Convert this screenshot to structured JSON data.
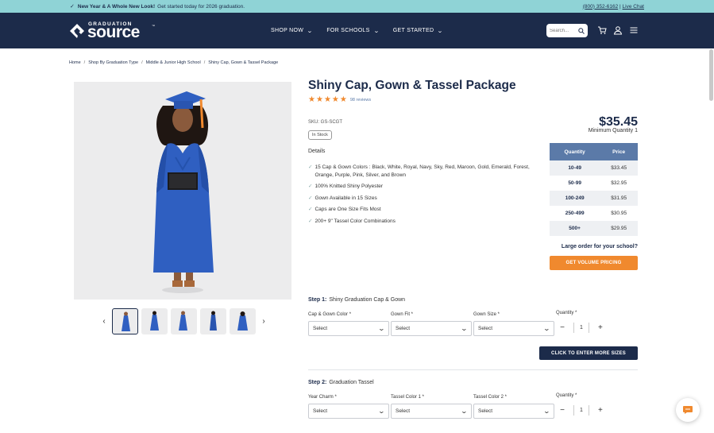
{
  "announcement": {
    "headline": "New Year & A Whole New Look!",
    "text": "Get started today for 2026 graduation.",
    "phone": "(800) 352-6162",
    "separator": "|",
    "live_chat": "Live Chat"
  },
  "header": {
    "logo_small": "GRADUATION",
    "logo_big": "source",
    "logo_tm": "™",
    "menu": [
      {
        "label": "SHOP NOW"
      },
      {
        "label": "FOR SCHOOLS"
      },
      {
        "label": "GET STARTED"
      }
    ],
    "search_placeholder": "Search...",
    "icons": [
      "search-icon",
      "cart-icon",
      "account-icon",
      "menu-icon"
    ]
  },
  "breadcrumb": [
    "Home",
    "Shop By Graduation Type",
    "Middle & Junior High School",
    "Shiny Cap, Gown & Tassel Package"
  ],
  "breadcrumb_separator": "/",
  "product": {
    "title": "Shiny Cap, Gown & Tassel Package",
    "reviews": "98 reviews",
    "stars": 5,
    "sku": "SKU: GS-SCGT",
    "stock": "In Stock",
    "details_label": "Details",
    "details": [
      "15 Cap & Gown Colors : Black, White, Royal, Navy, Sky, Red, Maroon, Gold, Emerald, Forest, Orange, Purple, Pink, Silver, and Brown",
      "100% Knitted Shiny Polyester",
      "Gown Available in 15 Sizes",
      "Caps are One Size Fits Most",
      "200+ 9\" Tassel Color Combinations"
    ],
    "price": "$35.45",
    "min_quantity": "Minimum Quantity 1",
    "image_colors": {
      "gown": "#2f5fc1",
      "tassel": "#f0892e",
      "background": "#ececed"
    }
  },
  "pricing_table": {
    "headers": [
      "Quantity",
      "Price"
    ],
    "rows": [
      {
        "qty": "10-49",
        "price": "$33.45"
      },
      {
        "qty": "50-99",
        "price": "$32.95"
      },
      {
        "qty": "100-249",
        "price": "$31.95"
      },
      {
        "qty": "250-499",
        "price": "$30.95"
      },
      {
        "qty": "500+",
        "price": "$29.95"
      }
    ]
  },
  "volume": {
    "prompt": "Large order for your school?",
    "button": "GET VOLUME PRICING"
  },
  "step1": {
    "label": "Step 1:",
    "name": "Shiny Graduation Cap & Gown",
    "fields": [
      {
        "label": "Cap & Gown Color *",
        "value": "Select"
      },
      {
        "label": "Gown Fit *",
        "value": "Select"
      },
      {
        "label": "Gown Size *",
        "value": "Select"
      }
    ],
    "quantity_label": "Quantity *",
    "quantity": "1",
    "enter_sizes_button": "CLICK TO ENTER MORE SIZES"
  },
  "step2": {
    "label": "Step 2:",
    "name": "Graduation Tassel",
    "fields": [
      {
        "label": "Year Charm *",
        "value": "Select"
      },
      {
        "label": "Tassel Color 1 *",
        "value": "Select"
      },
      {
        "label": "Tassel Color 2 *",
        "value": "Select"
      }
    ],
    "quantity_label": "Quantity *",
    "quantity": "1"
  },
  "colors": {
    "navy": "#1c2b4a",
    "announce": "#8fd3d6",
    "accent": "#f0892e",
    "table_header": "#5b7aa8"
  }
}
